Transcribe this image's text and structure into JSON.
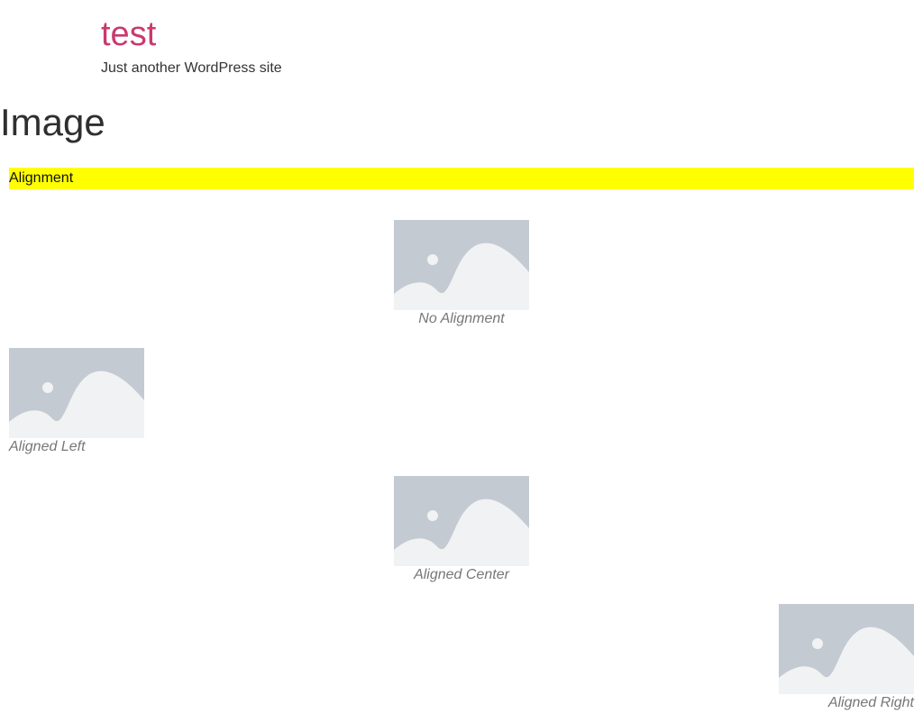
{
  "site": {
    "title": "test",
    "tagline": "Just another WordPress site"
  },
  "page": {
    "title": "Image"
  },
  "section": {
    "heading": "Alignment"
  },
  "images": [
    {
      "caption": "No Alignment",
      "alignment": "none"
    },
    {
      "caption": "Aligned Left",
      "alignment": "left"
    },
    {
      "caption": "Aligned Center",
      "alignment": "center"
    },
    {
      "caption": "Aligned Right",
      "alignment": "right"
    }
  ],
  "placeholder_icon": "image-placeholder-icon",
  "colors": {
    "site_title": "#c83a6e",
    "highlight": "#ffff00",
    "placeholder_bg": "#c3cad2",
    "placeholder_fg": "#f0f2f4"
  }
}
